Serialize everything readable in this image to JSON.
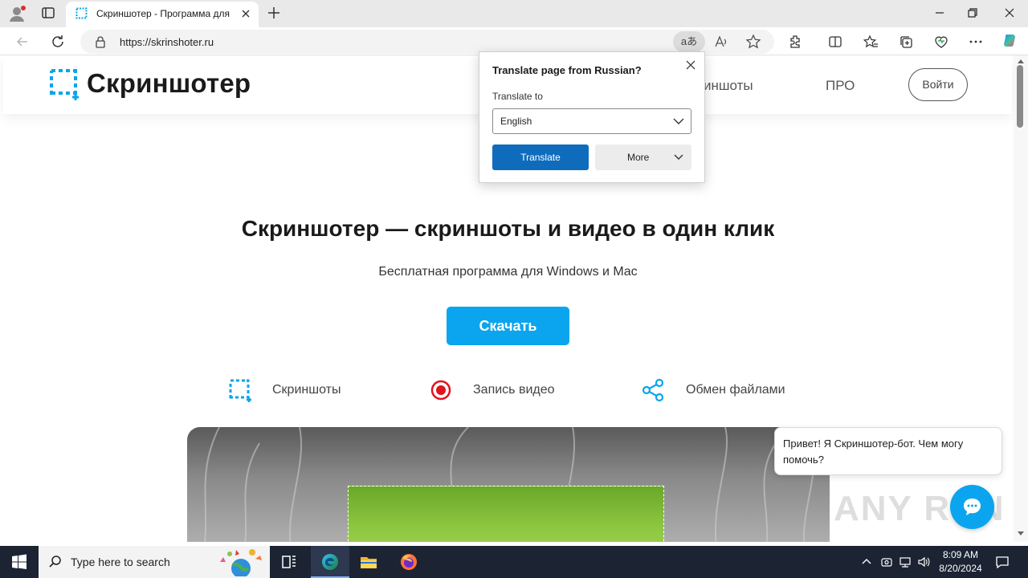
{
  "browser": {
    "tab_title": "Скриншотер - Программа для",
    "url": "https://skrinshoter.ru",
    "translate_pill": "aあ"
  },
  "site": {
    "logo_text": "Скриншотер",
    "nav": [
      "Скриншоты",
      "ПРО"
    ],
    "nav_visible_fragment": "иншоты",
    "login": "Войти",
    "hero_title": "Скриншотер — скриншоты и видео в один клик",
    "hero_subtitle": "Бесплатная программа для Windows и Mac",
    "download": "Скачать",
    "features": [
      {
        "label": "Скриншоты",
        "icon": "crop-select-icon"
      },
      {
        "label": "Запись видео",
        "icon": "record-icon"
      },
      {
        "label": "Обмен файлами",
        "icon": "share-icon"
      }
    ],
    "chat_message": "Привет! Я Скриншотер-бот. Чем могу помочь?",
    "watermark": "ANY RUN"
  },
  "translate_popup": {
    "title": "Translate page from Russian?",
    "translate_to_label": "Translate to",
    "selected_language": "English",
    "translate_button": "Translate",
    "more_button": "More"
  },
  "taskbar": {
    "search_placeholder": "Type here to search",
    "time": "8:09 AM",
    "date": "8/20/2024"
  },
  "colors": {
    "brand_blue": "#0aa5ee",
    "record_red": "#e0141e",
    "translate_blue": "#0f6cbd",
    "taskbar": "#1c2433"
  }
}
